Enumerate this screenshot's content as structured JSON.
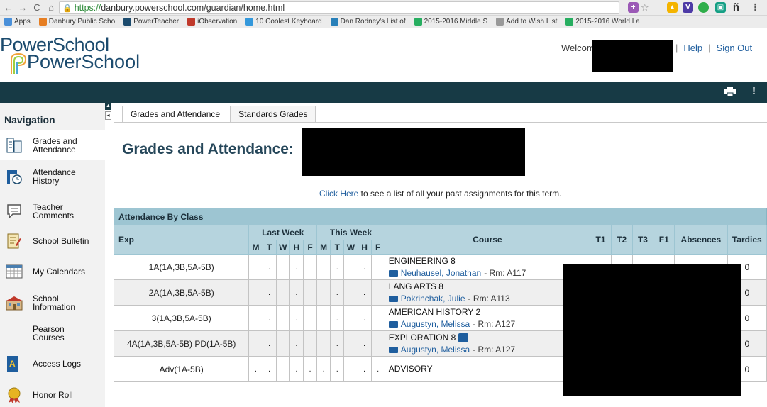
{
  "browser": {
    "url_scheme": "https://",
    "url_rest": "danbury.powerschool.com/guardian/home.html",
    "bookmarks": [
      {
        "label": "Apps",
        "color": "#4a90d9"
      },
      {
        "label": "Danbury Public Scho",
        "color": "#e67e22"
      },
      {
        "label": "PowerTeacher",
        "color": "#1c4b6e"
      },
      {
        "label": "iObservation",
        "color": "#c0392b"
      },
      {
        "label": "10 Coolest Keyboard",
        "color": "#3498db"
      },
      {
        "label": "Dan Rodney's List of",
        "color": "#2980b9"
      },
      {
        "label": "2015-2016 Middle S",
        "color": "#27ae60"
      },
      {
        "label": "Add to Wish List",
        "color": "#999999"
      },
      {
        "label": "2015-2016 World La",
        "color": "#27ae60"
      }
    ]
  },
  "header": {
    "logo_line1": "PowerSchool",
    "logo_line2": "PowerSchool",
    "welcome": "Welcome,",
    "help": "Help",
    "sign_out": "Sign Out",
    "separator": "|"
  },
  "sidebar": {
    "title": "Navigation",
    "items": [
      {
        "label": "Grades and Attendance",
        "icon": "grades-icon"
      },
      {
        "label": "Attendance History",
        "icon": "attendance-history-icon"
      },
      {
        "label": "Teacher Comments",
        "icon": "comments-icon"
      },
      {
        "label": "School Bulletin",
        "icon": "bulletin-icon"
      },
      {
        "label": "My Calendars",
        "icon": "calendar-icon"
      },
      {
        "label": "School Information",
        "icon": "school-icon"
      },
      {
        "label": "Pearson Courses",
        "icon": ""
      },
      {
        "label": "Access Logs",
        "icon": "access-logs-icon"
      },
      {
        "label": "Honor Roll",
        "icon": "honor-roll-icon"
      }
    ]
  },
  "tabs": [
    "Grades and Attendance",
    "Standards Grades"
  ],
  "main": {
    "title": "Grades and Attendance:",
    "assign_link": "Click Here",
    "assign_rest": " to see a list of all your past assignments for this term."
  },
  "table": {
    "caption": "Attendance By Class",
    "exp_header": "Exp",
    "last_week": "Last Week",
    "this_week": "This Week",
    "days": [
      "M",
      "T",
      "W",
      "H",
      "F",
      "M",
      "T",
      "W",
      "H",
      "F"
    ],
    "course_header": "Course",
    "grade_headers": [
      "T1",
      "T2",
      "T3",
      "F1"
    ],
    "absences_header": "Absences",
    "tardies_header": "Tardies",
    "rows": [
      {
        "exp": "1A(1A,3B,5A-5B)",
        "days": [
          "",
          ".",
          "",
          ".",
          "",
          "",
          ".",
          "",
          ".",
          ""
        ],
        "course": "ENGINEERING 8",
        "teacher": "Neuhausel, Jonathan",
        "room": " - Rm: A117",
        "tardies": "0"
      },
      {
        "exp": "2A(1A,3B,5A-5B)",
        "days": [
          "",
          ".",
          "",
          ".",
          "",
          "",
          ".",
          "",
          ".",
          ""
        ],
        "course": "LANG ARTS 8",
        "teacher": "Pokrinchak, Julie",
        "room": " - Rm: A113",
        "tardies": "0"
      },
      {
        "exp": "3(1A,3B,5A-5B)",
        "days": [
          "",
          ".",
          "",
          ".",
          "",
          "",
          ".",
          "",
          ".",
          ""
        ],
        "course": "AMERICAN HISTORY 2",
        "teacher": "Augustyn, Melissa",
        "room": " - Rm: A127",
        "tardies": "0"
      },
      {
        "exp": "4A(1A,3B,5A-5B) PD(1A-5B)",
        "days": [
          "",
          ".",
          "",
          ".",
          "",
          "",
          ".",
          "",
          ".",
          ""
        ],
        "course": "EXPLORATION 8",
        "teacher": "Augustyn, Melissa",
        "room": " - Rm: A127",
        "tardies": "0"
      },
      {
        "exp": "Adv(1A-5B)",
        "days": [
          ".",
          ".",
          "",
          ".",
          ".",
          ".",
          ".",
          "",
          ".",
          "."
        ],
        "course": "ADVISORY",
        "teacher": "",
        "room": "",
        "tardies": "0"
      }
    ]
  }
}
